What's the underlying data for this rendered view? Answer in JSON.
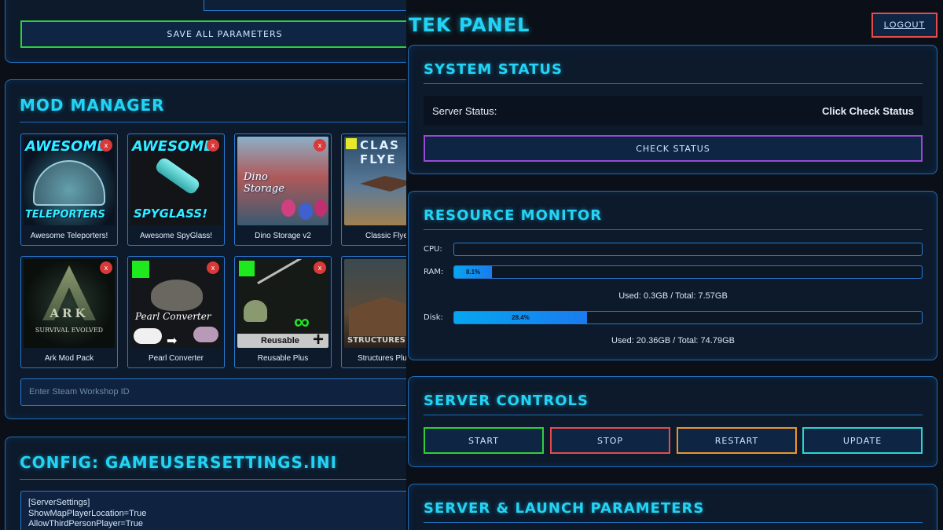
{
  "left": {
    "save_button_label": "SAVE ALL PARAMETERS",
    "mod_manager": {
      "title": "MOD MANAGER",
      "mods": [
        {
          "name": "Awesome Teleporters!",
          "art_top": "AWESOME",
          "art_bottom": "TELEPORTERS",
          "remove": "x"
        },
        {
          "name": "Awesome SpyGlass!",
          "art_top": "AWESOME",
          "art_bottom": "SPYGLASS!",
          "remove": "x"
        },
        {
          "name": "Dino Storage v2",
          "art_text": "Dino Storage",
          "remove": "x"
        },
        {
          "name": "Classic Flye",
          "art_text": "CLAS FLYE"
        },
        {
          "name": "Ark Mod Pack",
          "art_top": "ARK",
          "art_bottom": "SURVIVAL EVOLVED",
          "remove": "x"
        },
        {
          "name": "Pearl Converter",
          "art_text": "Pearl Converter",
          "remove": "x"
        },
        {
          "name": "Reusable Plus",
          "art_text": "Reusable",
          "remove": "x"
        },
        {
          "name": "Structures Plus",
          "art_text": "STRUCTURES"
        }
      ],
      "workshop_placeholder": "Enter Steam Workshop ID"
    },
    "config": {
      "title": "CONFIG: GAMEUSERSETTINGS.INI",
      "lines": [
        "[ServerSettings]",
        "ShowMapPlayerLocation=True",
        "AllowThirdPersonPlayer=True"
      ]
    }
  },
  "right": {
    "header_title": "TEK PANEL",
    "logout_label": "LOGOUT",
    "system_status": {
      "title": "SYSTEM STATUS",
      "label": "Server Status:",
      "value": "Click Check Status",
      "button": "CHECK STATUS"
    },
    "resource_monitor": {
      "title": "RESOURCE MONITOR",
      "cpu": {
        "label": "CPU:",
        "percent": 0,
        "text": ""
      },
      "ram": {
        "label": "RAM:",
        "percent": 8.1,
        "text": "8.1%",
        "usage": "Used: 0.3GB / Total: 7.57GB"
      },
      "disk": {
        "label": "Disk:",
        "percent": 28.4,
        "text": "28.4%",
        "usage": "Used: 20.36GB / Total: 74.79GB"
      }
    },
    "server_controls": {
      "title": "SERVER CONTROLS",
      "buttons": [
        {
          "label": "START",
          "color": "#2fcf3a"
        },
        {
          "label": "STOP",
          "color": "#e84a4a"
        },
        {
          "label": "RESTART",
          "color": "#f0942a"
        },
        {
          "label": "UPDATE",
          "color": "#2ad6d0"
        }
      ]
    },
    "launch_params": {
      "title": "SERVER & LAUNCH PARAMETERS"
    }
  },
  "colors": {
    "accent": "#23d3f5",
    "border": "#1f6db8",
    "background": "#0b0f17",
    "bar": "#06a6f0"
  }
}
